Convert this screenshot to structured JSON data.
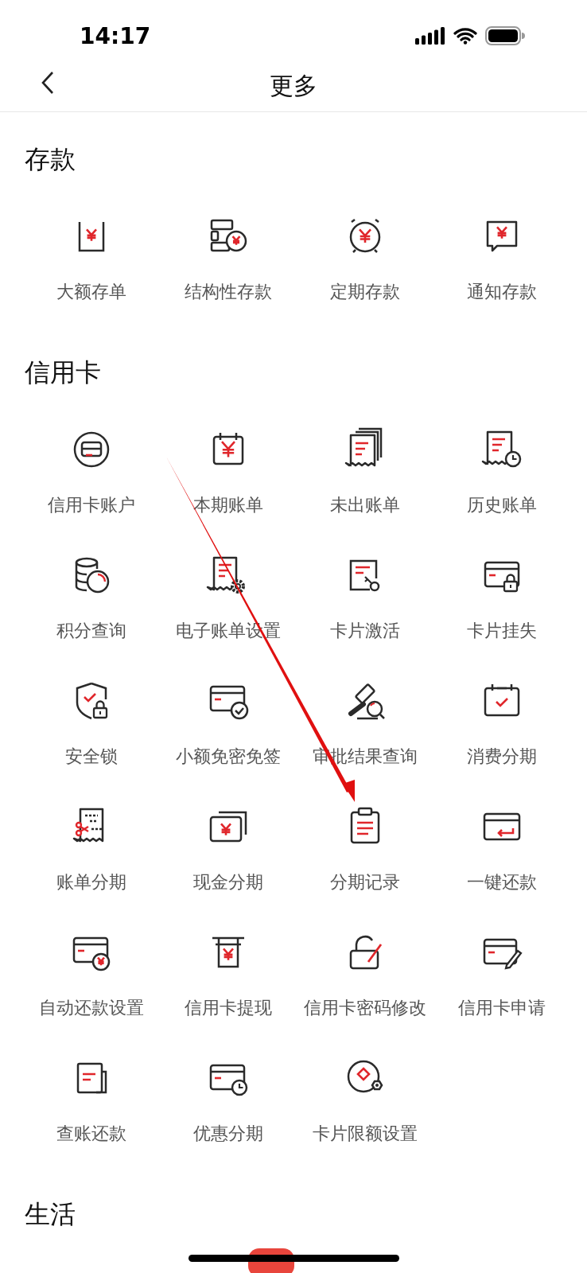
{
  "status_bar": {
    "time": "14:17"
  },
  "header": {
    "title": "更多"
  },
  "sections": [
    {
      "title": "存款",
      "items": [
        {
          "label": "大额存单"
        },
        {
          "label": "结构性存款"
        },
        {
          "label": "定期存款"
        },
        {
          "label": "通知存款"
        }
      ]
    },
    {
      "title": "信用卡",
      "items": [
        {
          "label": "信用卡账户"
        },
        {
          "label": "本期账单"
        },
        {
          "label": "未出账单"
        },
        {
          "label": "历史账单"
        },
        {
          "label": "积分查询"
        },
        {
          "label": "电子账单设置"
        },
        {
          "label": "卡片激活"
        },
        {
          "label": "卡片挂失"
        },
        {
          "label": "安全锁"
        },
        {
          "label": "小额免密免签"
        },
        {
          "label": "审批结果查询"
        },
        {
          "label": "消费分期"
        },
        {
          "label": "账单分期"
        },
        {
          "label": "现金分期"
        },
        {
          "label": "分期记录"
        },
        {
          "label": "一键还款"
        },
        {
          "label": "自动还款设置"
        },
        {
          "label": "信用卡提现"
        },
        {
          "label": "信用卡密码修改"
        },
        {
          "label": "信用卡申请"
        },
        {
          "label": "查账还款"
        },
        {
          "label": "优惠分期"
        },
        {
          "label": "卡片限额设置"
        }
      ]
    },
    {
      "title": "生活",
      "badge": true
    }
  ],
  "annotation": {
    "kind": "arrow"
  }
}
